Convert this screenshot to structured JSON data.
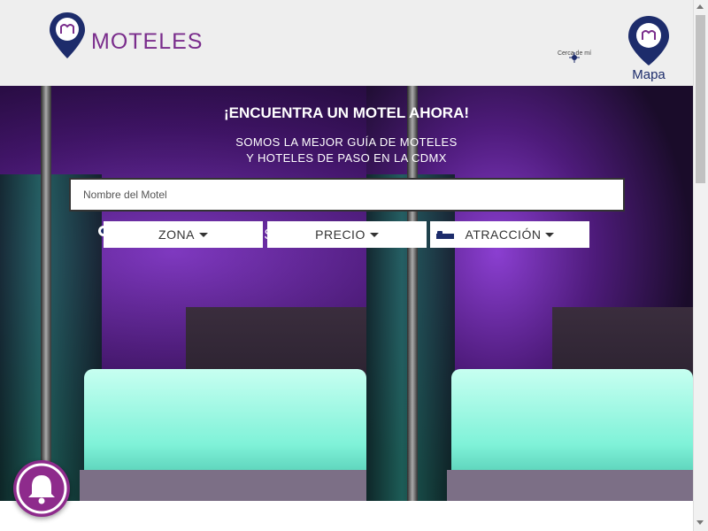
{
  "header": {
    "brand": "MOTELES",
    "near_me_label": "Cerca de mí",
    "map_label": "Mapa"
  },
  "hero": {
    "title": "¡ENCUENTRA UN MOTEL AHORA!",
    "subtitle_line1": "SOMOS LA MEJOR GUÍA DE MOTELES",
    "subtitle_line2": "Y HOTELES DE PASO EN LA CDMX"
  },
  "search": {
    "placeholder": "Nombre del Motel"
  },
  "filters": [
    {
      "label": "ZONA",
      "icon": "location-pin-icon"
    },
    {
      "label": "PRECIO",
      "icon": "dollar-icon"
    },
    {
      "label": "ATRACCIÓN",
      "icon": "bed-icon"
    }
  ],
  "colors": {
    "brand_purple": "#7a2d8c",
    "map_navy": "#1d2c6b",
    "bell_purple": "#8e2b8c"
  }
}
